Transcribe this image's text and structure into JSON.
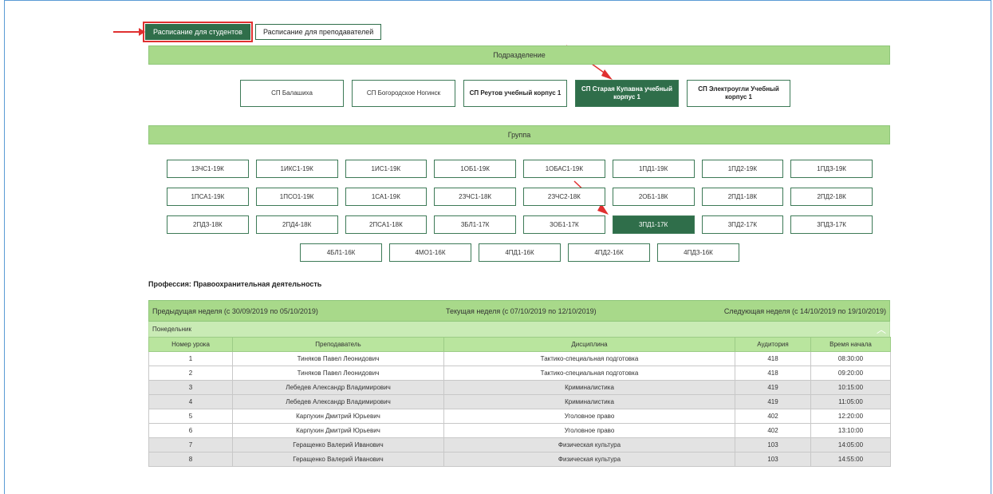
{
  "tabs": [
    {
      "label": "Расписание для студентов",
      "active": true
    },
    {
      "label": "Расписание для преподавателей",
      "active": false
    }
  ],
  "subdivision": {
    "header": "Подразделение",
    "items": [
      {
        "label": "СП Балашиха",
        "bold": false,
        "active": false
      },
      {
        "label": "СП Богородское Ногинск",
        "bold": false,
        "active": false
      },
      {
        "label": "СП Реутов учебный корпус 1",
        "bold": true,
        "active": false
      },
      {
        "label": "СП Старая Купавна учебный корпус 1",
        "bold": true,
        "active": true
      },
      {
        "label": "СП Электроугли Учебный корпус 1",
        "bold": true,
        "active": false
      }
    ]
  },
  "group": {
    "header": "Группа",
    "rows": [
      [
        "1ЗЧС1-19К",
        "1ИКС1-19К",
        "1ИС1-19К",
        "1ОБ1-19К",
        "1ОБАС1-19К",
        "1ПД1-19К",
        "1ПД2-19К",
        "1ПДЗ-19К"
      ],
      [
        "1ПСА1-19К",
        "1ПСО1-19К",
        "1СА1-19К",
        "2ЗЧС1-18К",
        "2ЗЧС2-18К",
        "2ОБ1-18К",
        "2ПД1-18К",
        "2ПД2-18К"
      ],
      [
        "2ПДЗ-18К",
        "2ПД4-18К",
        "2ПСА1-18К",
        "3БЛ1-17К",
        "3ОБ1-17К",
        "3ПД1-17К",
        "3ПД2-17К",
        "3ПДЗ-17К"
      ],
      [
        "4БЛ1-16К",
        "4МО1-16К",
        "4ПД1-16К",
        "4ПД2-16К",
        "4ПДЗ-16К"
      ]
    ],
    "active": "3ПД1-17К"
  },
  "profession": "Профессия: Правоохранительная деятельность",
  "weeks": {
    "previous": "Предыдущая неделя (с 30/09/2019 по 05/10/2019)",
    "current": "Текущая неделя (с 07/10/2019 по 12/10/2019)",
    "next": "Следующая неделя (с 14/10/2019 по 19/10/2019)"
  },
  "day": "Понедельник",
  "columns": [
    "Номер урока",
    "Преподаватель",
    "Дисциплина",
    "Аудитория",
    "Время начала"
  ],
  "lessons": [
    [
      "1",
      "Тиняков Павел Леонидович",
      "Тактико-специальная подготовка",
      "418",
      "08:30:00"
    ],
    [
      "2",
      "Тиняков Павел Леонидович",
      "Тактико-специальная подготовка",
      "418",
      "09:20:00"
    ],
    [
      "3",
      "Лебедев Александр Владимирович",
      "Криминалистика",
      "419",
      "10:15:00"
    ],
    [
      "4",
      "Лебедев Александр Владимирович",
      "Криминалистика",
      "419",
      "11:05:00"
    ],
    [
      "5",
      "Карпухин Дмитрий Юрьевич",
      "Уголовное право",
      "402",
      "12:20:00"
    ],
    [
      "6",
      "Карпухин Дмитрий Юрьевич",
      "Уголовное право",
      "402",
      "13:10:00"
    ],
    [
      "7",
      "Геращенко Валерий Иванович",
      "Физическая культура",
      "103",
      "14:05:00"
    ],
    [
      "8",
      "Геращенко Валерий Иванович",
      "Физическая культура",
      "103",
      "14:55:00"
    ]
  ],
  "colors": {
    "accent": "#2f6e4a",
    "bar": "#a8d98a",
    "arrow": "#e03030"
  }
}
